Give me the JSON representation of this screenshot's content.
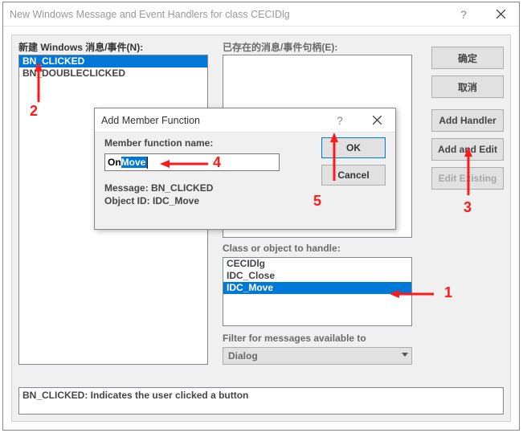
{
  "window": {
    "title": "New Windows Message and Event Handlers for class CECIDlg"
  },
  "labels": {
    "new_messages": "新建 Windows 消息/事件(N):",
    "existing": "已存在的消息/事件句柄(E):",
    "class_object": "Class or object to handle:",
    "filter": "Filter for messages available to"
  },
  "new_messages_list": [
    "BN_CLICKED",
    "BN_DOUBLECLICKED"
  ],
  "new_messages_selected": 0,
  "class_list": [
    "CECIDlg",
    "IDC_Close",
    "IDC_Move"
  ],
  "class_selected": 2,
  "filter_value": "Dialog",
  "buttons": {
    "ok": "确定",
    "cancel": "取消",
    "add_handler": "Add Handler",
    "add_edit": "Add and Edit",
    "edit_existing": "Edit Existing"
  },
  "status_text": "BN_CLICKED:  Indicates the user clicked a button",
  "modal": {
    "title": "Add Member Function",
    "name_label": "Member function name:",
    "prefix": "On",
    "selected": "Move",
    "message_label": "Message: BN_CLICKED",
    "object_label": "Object ID: IDC_Move",
    "ok": "OK",
    "cancel": "Cancel"
  },
  "annotations": {
    "n1": "1",
    "n2": "2",
    "n3": "3",
    "n4": "4",
    "n5": "5"
  }
}
